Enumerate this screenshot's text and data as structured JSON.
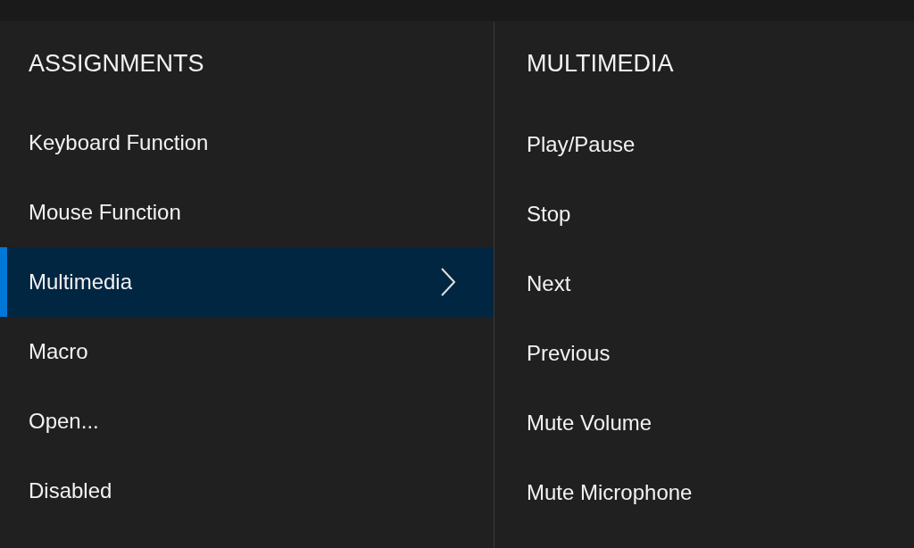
{
  "assignments": {
    "title": "ASSIGNMENTS",
    "items": [
      {
        "label": "Keyboard Function",
        "selected": false
      },
      {
        "label": "Mouse Function",
        "selected": false
      },
      {
        "label": "Multimedia",
        "selected": true
      },
      {
        "label": "Macro",
        "selected": false
      },
      {
        "label": "Open...",
        "selected": false
      },
      {
        "label": "Disabled",
        "selected": false
      }
    ]
  },
  "multimedia": {
    "title": "MULTIMEDIA",
    "items": [
      {
        "label": "Play/Pause"
      },
      {
        "label": "Stop"
      },
      {
        "label": "Next"
      },
      {
        "label": "Previous"
      },
      {
        "label": "Mute Volume"
      },
      {
        "label": "Mute Microphone"
      }
    ]
  }
}
